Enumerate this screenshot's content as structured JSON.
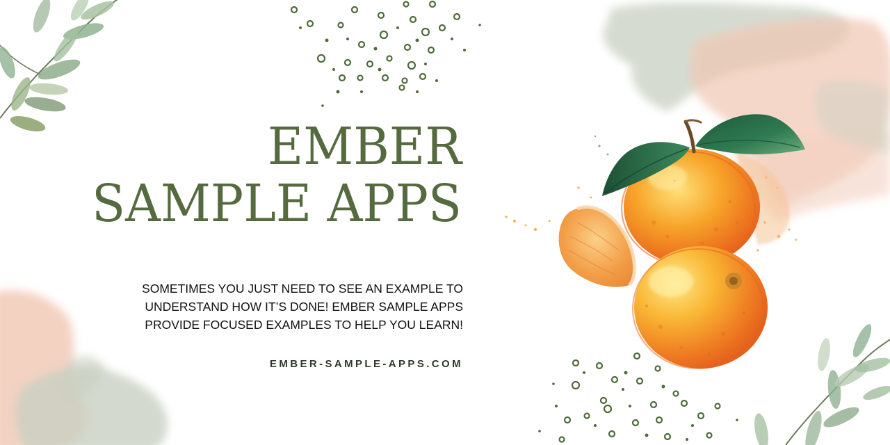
{
  "banner": {
    "title_lines": [
      "EMBER",
      "SAMPLE APPS"
    ],
    "tagline_lines": [
      "SOMETIMES YOU JUST NEED TO SEE AN EXAMPLE TO",
      "UNDERSTAND HOW IT’S DONE! EMBER SAMPLE APPS",
      "PROVIDE FOCUSED EXAMPLES TO HELP YOU LEARN!"
    ],
    "website": "EMBER-SAMPLE-APPS.COM"
  },
  "colors": {
    "title": "#556b3f",
    "body_text": "#111111",
    "website": "#2f3a2a",
    "dots": "#4f6b3a",
    "orange": "#f39a22",
    "leaf": "#2f6b46",
    "sage_wash": "#c9d0c2",
    "peach_wash": "#f1c7b3"
  },
  "icons": {
    "decor": [
      "leaf-branch-icon",
      "dot-pattern-icon",
      "watercolor-orange-icon",
      "watercolor-wash-icon"
    ]
  }
}
